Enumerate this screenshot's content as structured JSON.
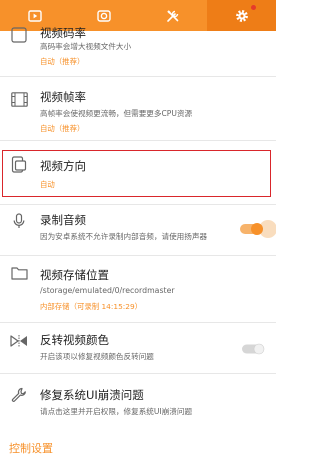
{
  "tabs": [
    {
      "icon": "video-icon",
      "active": false
    },
    {
      "icon": "camera-icon",
      "active": false
    },
    {
      "icon": "tools-icon",
      "active": false
    },
    {
      "icon": "gear-icon",
      "active": true
    }
  ],
  "settings": {
    "bitrate": {
      "title": "视频码率",
      "desc": "高码率会增大视频文件大小",
      "value": "自动（推荐）"
    },
    "framerate": {
      "title": "视频帧率",
      "desc": "高帧率会使视频更流畅，但需要更多CPU资源",
      "value": "自动（推荐）"
    },
    "orientation": {
      "title": "视频方向",
      "value": "自动"
    },
    "audio": {
      "title": "录制音频",
      "desc": "因为安卓系统不允许录制内部音频，请使用扬声器",
      "enabled": true
    },
    "storage": {
      "title": "视频存储位置",
      "path": "/storage/emulated/0/recordmaster",
      "value": "内部存储（可录制 14:15:29）"
    },
    "flip": {
      "title": "反转视频颜色",
      "desc": "开启该项以修复视频颜色反转问题",
      "enabled": false
    },
    "fix_ui": {
      "title": "修复系统UI崩溃问题",
      "desc": "请点击这里并开启权限，修复系统UI崩溃问题"
    }
  },
  "section_header": "控制设置",
  "colors": {
    "accent": "#f7912a",
    "highlight": "#d9262b"
  }
}
